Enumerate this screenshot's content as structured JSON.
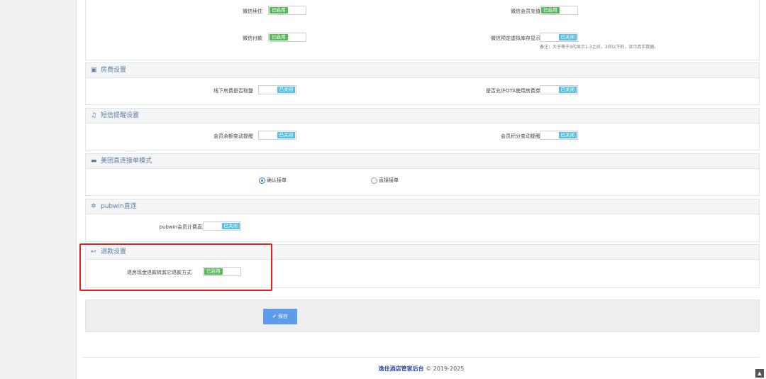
{
  "wechat": {
    "items": [
      {
        "label": "微信续住",
        "state": "on",
        "text": "已启用"
      },
      {
        "label": "微信会员充值",
        "state": "on",
        "text": "已启用"
      },
      {
        "label": "微信付款",
        "state": "on",
        "text": "已启用"
      },
      {
        "label": "微信预定虚拟库存显示",
        "state": "off",
        "text": "已关闭"
      }
    ],
    "note": "备注：大于等于3的显示1-3之间，3间以下的，显示真实数据。"
  },
  "room_fee": {
    "title": "房费设置",
    "icon": "money-icon",
    "items": [
      {
        "label": "线下房费是否取整",
        "state": "off",
        "text": "已关闭"
      },
      {
        "label": "是否允许OTA使用房费券",
        "state": "off",
        "text": "已关闭"
      }
    ]
  },
  "sms": {
    "title": "短信提醒设置",
    "icon": "bell-icon",
    "items": [
      {
        "label": "会员余额变动提醒",
        "state": "off",
        "text": "已关闭"
      },
      {
        "label": "会员积分变动提醒",
        "state": "off",
        "text": "已关闭"
      }
    ]
  },
  "meituan": {
    "title": "美团直连接单模式",
    "icon": "bed-icon",
    "options": [
      {
        "label": "确认接单",
        "selected": true
      },
      {
        "label": "直接接单",
        "selected": false
      }
    ]
  },
  "pubwin": {
    "title": "pubwin直连",
    "icon": "cogs-icon",
    "items": [
      {
        "label": "pubwin会员计费直连",
        "state": "off",
        "text": "已关闭"
      }
    ]
  },
  "refund": {
    "title": "退款设置",
    "icon": "reply-icon",
    "items": [
      {
        "label": "退房现金退款转其它退款方式",
        "state": "on",
        "text": "已启用"
      }
    ]
  },
  "save": {
    "label": "保存",
    "icon": "check-icon"
  },
  "footer": {
    "brand": "逸住酒店管家后台",
    "copyright": "© 2019-2025"
  },
  "colors": {
    "enabled": "#5cb85c",
    "disabled": "#5bc0de",
    "accent": "#5d9cec",
    "highlight": "#e02020"
  }
}
